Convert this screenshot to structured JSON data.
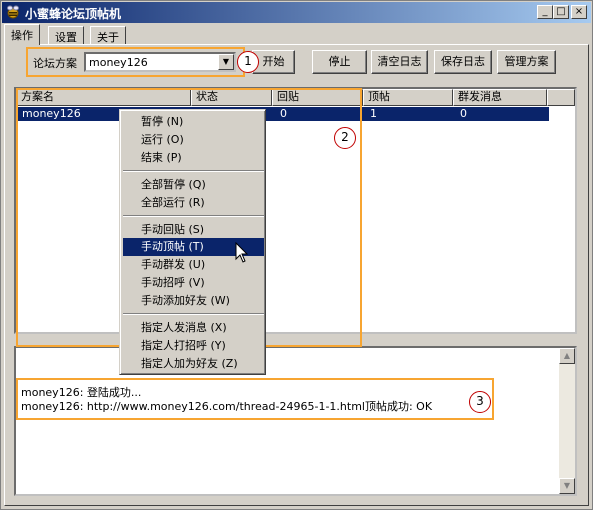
{
  "window": {
    "title": "小蜜蜂论坛顶帖机",
    "controls": {
      "minimize": "_",
      "maximize": "□",
      "close": "×"
    }
  },
  "tabs": [
    {
      "label": "操作",
      "active": true
    },
    {
      "label": "设置",
      "active": false
    },
    {
      "label": "关于",
      "active": false
    }
  ],
  "toolbar": {
    "scheme_label": "论坛方案",
    "scheme_value": "money126",
    "start_label": "开始",
    "stop_label": "停止",
    "clear_log_label": "清空日志",
    "save_log_label": "保存日志",
    "manage_label": "管理方案"
  },
  "callouts": [
    "1",
    "2",
    "3"
  ],
  "list": {
    "columns": [
      "方案名",
      "状态",
      "回贴",
      "顶帖",
      "群发消息"
    ],
    "rows": [
      {
        "name": "money126",
        "status": "",
        "reply": "0",
        "bump": "1",
        "mass": "0"
      }
    ]
  },
  "context_menu": {
    "items": [
      {
        "label": "暂停 (N)",
        "highlighted": false
      },
      {
        "label": "运行 (O)",
        "highlighted": false
      },
      {
        "label": "结束 (P)",
        "highlighted": false
      },
      {
        "label": "全部暂停 (Q)",
        "highlighted": false
      },
      {
        "label": "全部运行 (R)",
        "highlighted": false
      },
      {
        "label": "手动回贴 (S)",
        "highlighted": false
      },
      {
        "label": "手动顶帖 (T)",
        "highlighted": true
      },
      {
        "label": "手动群发 (U)",
        "highlighted": false
      },
      {
        "label": "手动招呼 (V)",
        "highlighted": false
      },
      {
        "label": "手动添加好友 (W)",
        "highlighted": false
      },
      {
        "label": "指定人发消息 (X)",
        "highlighted": false
      },
      {
        "label": "指定人打招呼 (Y)",
        "highlighted": false
      },
      {
        "label": "指定人加为好友 (Z)",
        "highlighted": false
      }
    ]
  },
  "log": {
    "lines": [
      "money126: 登陆成功...",
      "money126: http://www.money126.com/thread-24965-1-1.html顶帖成功: OK"
    ]
  },
  "colors": {
    "callout_border": "#f7a531",
    "selection": "#0a246a",
    "title_gradient_start": "#0a246a"
  }
}
